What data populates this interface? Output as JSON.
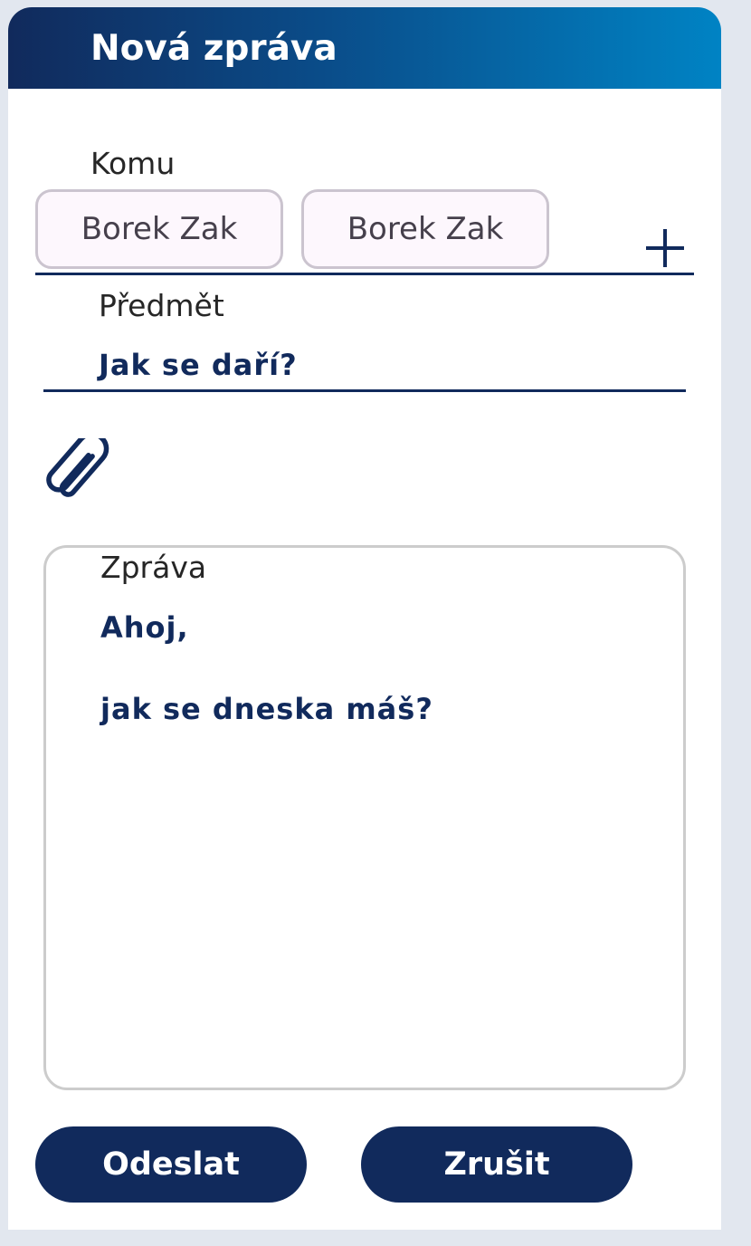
{
  "dialog": {
    "title": "Nová zpráva"
  },
  "recipients": {
    "label": "Komu",
    "chips": [
      {
        "name": "Borek Zak"
      },
      {
        "name": "Borek Zak"
      }
    ],
    "add_icon": "plus-icon"
  },
  "subject": {
    "label": "Předmět",
    "value": "Jak se daří?"
  },
  "attachment": {
    "icon": "paperclip-icon"
  },
  "message": {
    "label": "Zpráva",
    "lines": [
      "Ahoj,",
      "jak se dneska máš?"
    ]
  },
  "actions": {
    "send_label": "Odeslat",
    "cancel_label": "Zrušit"
  },
  "colors": {
    "primary": "#112a5c",
    "header_gradient_end": "#0083c4",
    "chip_background": "#fdf7fd",
    "chip_border": "#cbc4cf"
  }
}
